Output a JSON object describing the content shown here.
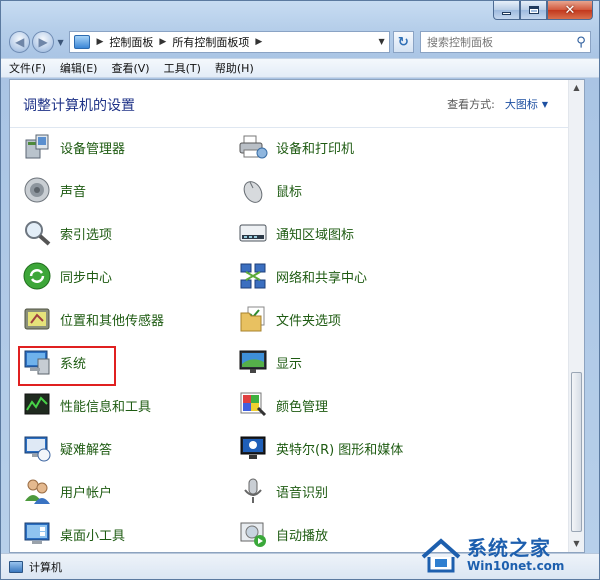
{
  "address": {
    "crumbs": [
      "控制面板",
      "所有控制面板项"
    ]
  },
  "search": {
    "placeholder": "搜索控制面板"
  },
  "menu": [
    "文件(F)",
    "编辑(E)",
    "查看(V)",
    "工具(T)",
    "帮助(H)"
  ],
  "header": {
    "title": "调整计算机的设置",
    "view_by_label": "查看方式:",
    "view_by_value": "大图标"
  },
  "items": [
    {
      "label": "设备管理器",
      "icon": "device-manager-icon"
    },
    {
      "label": "设备和打印机",
      "icon": "printer-icon"
    },
    {
      "label": "声音",
      "icon": "speaker-icon"
    },
    {
      "label": "鼠标",
      "icon": "mouse-icon"
    },
    {
      "label": "索引选项",
      "icon": "index-magnifier-icon"
    },
    {
      "label": "通知区域图标",
      "icon": "tray-icon"
    },
    {
      "label": "同步中心",
      "icon": "sync-icon"
    },
    {
      "label": "网络和共享中心",
      "icon": "network-icon"
    },
    {
      "label": "位置和其他传感器",
      "icon": "sensor-icon"
    },
    {
      "label": "文件夹选项",
      "icon": "folder-icon"
    },
    {
      "label": "系统",
      "icon": "system-icon"
    },
    {
      "label": "显示",
      "icon": "display-icon"
    },
    {
      "label": "性能信息和工具",
      "icon": "performance-icon"
    },
    {
      "label": "颜色管理",
      "icon": "color-management-icon"
    },
    {
      "label": "疑难解答",
      "icon": "troubleshoot-icon"
    },
    {
      "label": "英特尔(R) 图形和媒体",
      "icon": "intel-graphics-icon"
    },
    {
      "label": "用户帐户",
      "icon": "users-icon"
    },
    {
      "label": "语音识别",
      "icon": "microphone-icon"
    },
    {
      "label": "桌面小工具",
      "icon": "gadgets-icon"
    },
    {
      "label": "自动播放",
      "icon": "autoplay-icon"
    }
  ],
  "status": {
    "text": "计算机"
  },
  "watermark": {
    "title": "系统之家",
    "url": "Win10net.com"
  },
  "colors": {
    "link_green": "#1e5b12",
    "heading_blue": "#1e3287",
    "highlight_red": "#e02020"
  }
}
